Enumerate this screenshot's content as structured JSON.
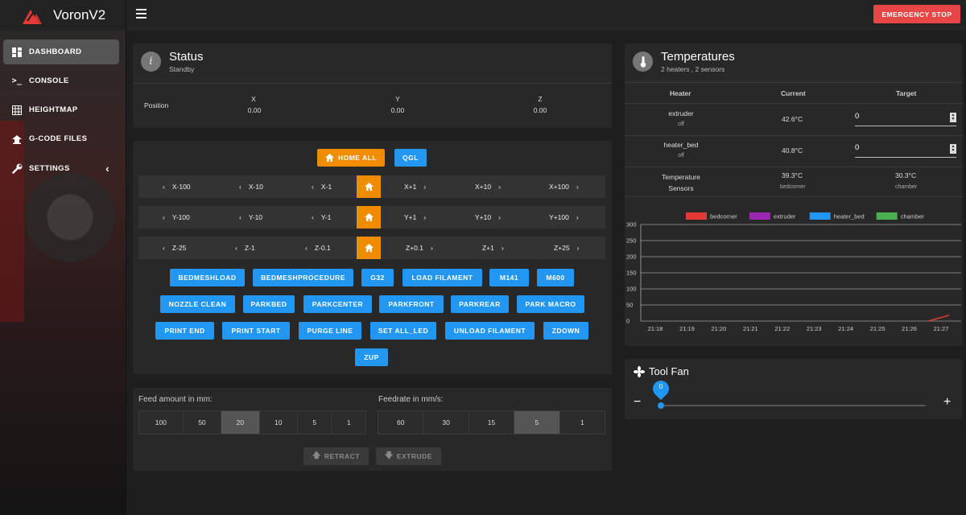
{
  "app": {
    "title": "VoronV2"
  },
  "sidebar": {
    "items": [
      {
        "label": "DASHBOARD",
        "icon": "dashboard-icon",
        "active": true
      },
      {
        "label": "CONSOLE",
        "icon": "console-icon",
        "active": false
      },
      {
        "label": "HEIGHTMAP",
        "icon": "grid-icon",
        "active": false
      },
      {
        "label": "G-CODE FILES",
        "icon": "file-upload-icon",
        "active": false
      },
      {
        "label": "SETTINGS",
        "icon": "wrench-icon",
        "active": false
      }
    ]
  },
  "topbar": {
    "emergency_label": "EMERGENCY STOP"
  },
  "status": {
    "title": "Status",
    "subtitle": "Standby",
    "position_label": "Position",
    "axes": [
      {
        "name": "X",
        "value": "0.00"
      },
      {
        "name": "Y",
        "value": "0.00"
      },
      {
        "name": "Z",
        "value": "0.00"
      }
    ]
  },
  "control": {
    "homeall_label": "HOME ALL",
    "qgl_label": "QGL",
    "x_jogs": [
      "X-100",
      "X-10",
      "X-1",
      "X+1",
      "X+10",
      "X+100"
    ],
    "y_jogs": [
      "Y-100",
      "Y-10",
      "Y-1",
      "Y+1",
      "Y+10",
      "Y+100"
    ],
    "z_jogs": [
      "Z-25",
      "Z-1",
      "Z-0.1",
      "Z+0.1",
      "Z+1",
      "Z+25"
    ],
    "macros": [
      "BEDMESHLOAD",
      "BEDMESHPROCEDURE",
      "G32",
      "LOAD FILAMENT",
      "M141",
      "M600",
      "NOZZLE CLEAN",
      "PARKBED",
      "PARKCENTER",
      "PARKFRONT",
      "PARKREAR",
      "PARK MACRO",
      "PRINT END",
      "PRINT START",
      "PURGE LINE",
      "SET ALL_LED",
      "UNLOAD FILAMENT",
      "ZDOWN",
      "ZUP"
    ]
  },
  "extruder": {
    "feed_label": "Feed amount in mm:",
    "feed_options": [
      "100",
      "50",
      "20",
      "10",
      "5",
      "1"
    ],
    "feed_selected": "20",
    "rate_label": "Feedrate in mm/s:",
    "rate_options": [
      "60",
      "30",
      "15",
      "5",
      "1"
    ],
    "rate_selected": "5",
    "retract_label": "RETRACT",
    "extrude_label": "EXTRUDE"
  },
  "temperatures": {
    "title": "Temperatures",
    "subtitle": "2 heaters , 2 sensors",
    "headers": {
      "heater": "Heater",
      "current": "Current",
      "target": "Target"
    },
    "heaters": [
      {
        "name": "extruder",
        "state": "off",
        "current": "42.6°C",
        "target": "0"
      },
      {
        "name": "heater_bed",
        "state": "off",
        "current": "40.8°C",
        "target": "0"
      }
    ],
    "sensors": {
      "label": "Temperature Sensors",
      "items": [
        {
          "value": "39.3°C",
          "name": "bedcorner"
        },
        {
          "value": "30.3°C",
          "name": "chamber"
        }
      ]
    }
  },
  "chart_data": {
    "type": "line",
    "x": [
      "21:18",
      "21:19",
      "21:20",
      "21:21",
      "21:22",
      "21:23",
      "21:24",
      "21:25",
      "21:26",
      "21:27"
    ],
    "ylim": [
      0,
      300
    ],
    "yticks": [
      "300",
      "250",
      "200",
      "150",
      "100",
      "50",
      "0"
    ],
    "grid": true,
    "legend_position": "top",
    "series": [
      {
        "name": "bedcorner",
        "color": "#e53935",
        "points": [
          [
            8.6,
            0
          ],
          [
            9.25,
            18
          ]
        ]
      },
      {
        "name": "extruder",
        "color": "#9c27b0",
        "points": []
      },
      {
        "name": "heater_bed",
        "color": "#2196f3",
        "points": []
      },
      {
        "name": "chamber",
        "color": "#4caf50",
        "points": []
      }
    ]
  },
  "toolfan": {
    "title": "Tool Fan",
    "value": "0",
    "minus": "−",
    "plus": "+"
  },
  "colors": {
    "accent": "#2196f3",
    "orange": "#f08c00",
    "estop": "#e84646"
  }
}
